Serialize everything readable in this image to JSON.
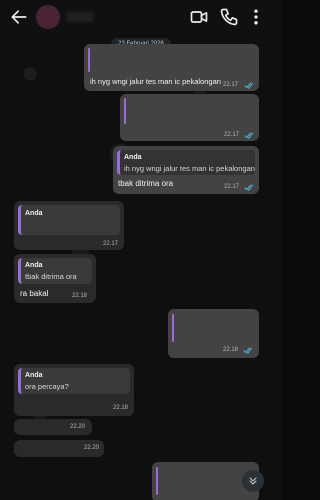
{
  "date_chip": "23 Februari 2026",
  "messages": [
    {
      "text": "ih nyg wngi jalur tes man ic pekalongan",
      "time": "22.17"
    },
    {
      "time": "22.17"
    },
    {
      "quote_name": "Anda",
      "quote_text": "ih nyg wngi jalur tes man ic pekalongan",
      "text": "tbak ditrima ora",
      "time": "22.17"
    },
    {
      "quote_name": "Anda",
      "time": "22.17"
    },
    {
      "quote_name": "Anda",
      "quote_text": "tbak ditrima ora",
      "text": "ra bakal",
      "time": "22.18"
    },
    {
      "time": "22.18"
    },
    {
      "quote_name": "Anda",
      "quote_text": "ora percaya?",
      "time": "22.18"
    },
    {
      "time": "22.20"
    },
    {
      "time": "22.20"
    }
  ],
  "colors": {
    "accent_bar": "#9a6cd8",
    "read_ticks": "#53bdeb",
    "avatar": "#4a2334"
  },
  "icons": [
    "back-arrow-icon",
    "video-call-icon",
    "phone-icon",
    "more-vert-icon",
    "chevron-down-icon",
    "read-ticks-icon"
  ]
}
